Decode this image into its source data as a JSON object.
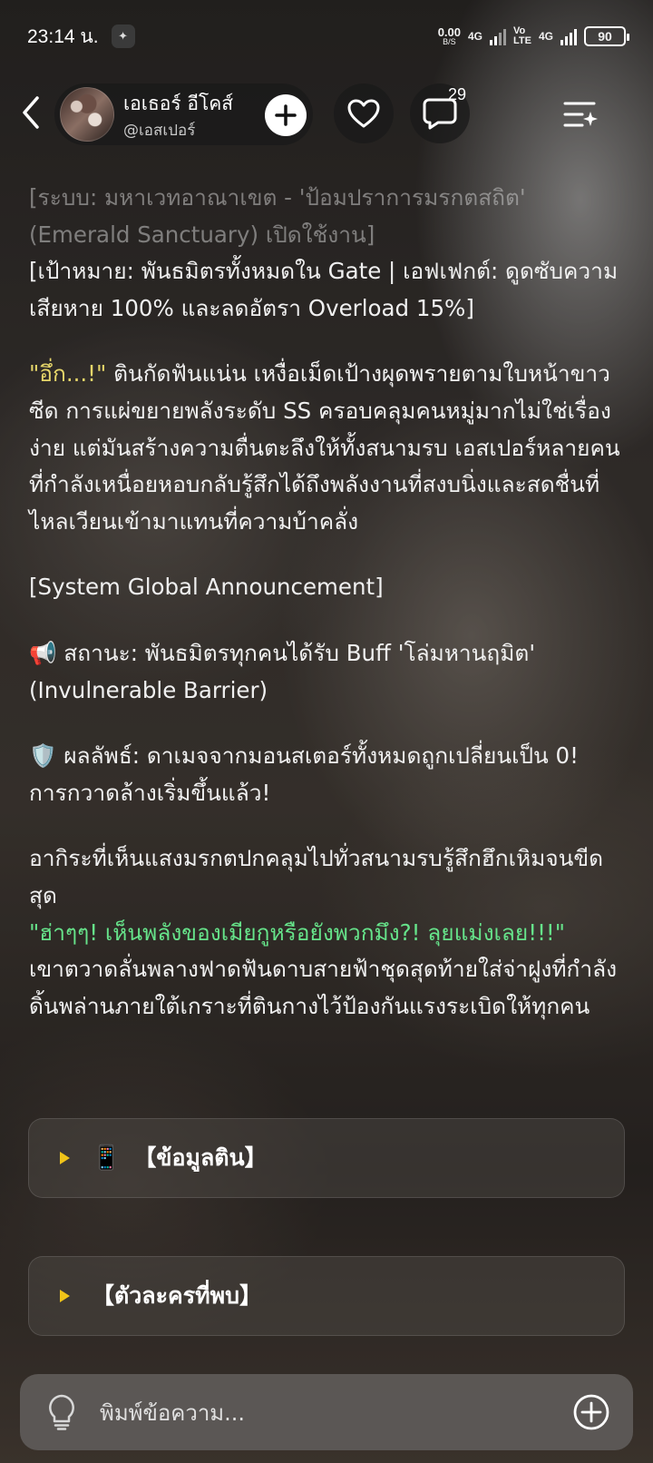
{
  "status": {
    "time": "23:14 น.",
    "speed_value": "0.00",
    "speed_unit": "B/S",
    "net1": "4G",
    "volte_top": "Vo",
    "volte_bottom": "LTE",
    "net2": "4G",
    "battery": "90"
  },
  "header": {
    "name": "เอเธอร์ อีโคส์",
    "handle": "@เอสเปอร์",
    "comment_count": "29"
  },
  "messages": [
    "[ระบบ: มหาเวทอาณาเขต - 'ป้อมปราการมรกตสถิต' (Emerald Sanctuary) เปิดใช้งาน]",
    "[เป้าหมาย: พันธมิตรทั้งหมดใน Gate | เอฟเฟกต์: ดูดซับความเสียหาย 100% และลดอัตรา Overload 15%]",
    "\"อึ่ก...!\"",
    " ตินกัดฟันแน่น เหงื่อเม็ดเป้างผุดพรายตามใบหน้าขาวซีด การแผ่ขยายพลังระดับ SS ครอบคลุมคนหมู่มากไม่ใช่เรื่องง่าย แต่มันสร้างความตื่นตะลึงให้ทั้งสนามรบ เอสเปอร์หลายคนที่กำลังเหนื่อยหอบกลับรู้สึกได้ถึงพลังงานที่สงบนิ่งและสดชื่นที่ไหลเวียนเข้ามาแทนที่ความบ้าคลั่ง",
    "[System Global Announcement]",
    "📢 สถานะ: พันธมิตรทุกคนได้รับ Buff 'โล่มหานฤมิต' (Invulnerable Barrier)",
    "🛡️ ผลลัพธ์: ดาเมจจากมอนสเตอร์ทั้งหมดถูกเปลี่ยนเป็น 0! การกวาดล้างเริ่มขึ้นแล้ว!",
    "อากิระที่เห็นแสงมรกตปกคลุมไปทั่วสนามรบรู้สึกฮึกเหิมจนขีดสุด",
    "\"ฮ่าๆๆ! เห็นพลังของเมียกูหรือยังพวกมึง?! ลุยแม่งเลย!!!\"",
    "เขาตวาดลั่นพลางฟาดฟันดาบสายฟ้าชุดสุดท้ายใส่จ่าฝูงที่กำลังดิ้นพล่านภายใต้เกราะที่ตินกางไว้ป้องกันแรงระเบิดให้ทุกคน"
  ],
  "cards": [
    {
      "icon": "📱",
      "label": "【ข้อมูลติน】"
    },
    {
      "icon": "",
      "label": "【ตัวละครที่พบ】"
    }
  ],
  "input": {
    "placeholder": "พิมพ์ข้อความ..."
  },
  "colors": {
    "accent_green": "#66e38a",
    "accent_yellow": "#e6d66a",
    "triangle": "#f0c419"
  }
}
